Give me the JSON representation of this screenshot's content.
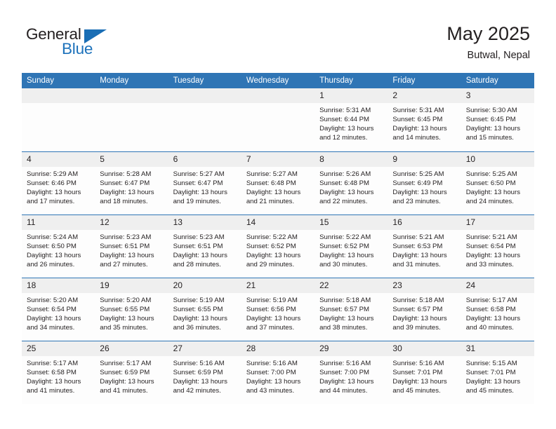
{
  "brand": {
    "name_part1": "General",
    "name_part2": "Blue",
    "accent_color": "#1d72bb",
    "triangle_color": "#1a6eb5"
  },
  "header": {
    "title": "May 2025",
    "subtitle": "Butwal, Nepal"
  },
  "theme": {
    "header_bg": "#2f75b5",
    "header_text": "#ffffff",
    "daynum_bg": "#efefef",
    "cell_bg": "#fdfdfd",
    "text": "#231f20"
  },
  "weekday_headers": [
    "Sunday",
    "Monday",
    "Tuesday",
    "Wednesday",
    "Thursday",
    "Friday",
    "Saturday"
  ],
  "labels": {
    "sunrise_prefix": "Sunrise:",
    "sunset_prefix": "Sunset:",
    "daylight_prefix": "Daylight:"
  },
  "weeks": [
    [
      {
        "day": "",
        "empty": true
      },
      {
        "day": "",
        "empty": true
      },
      {
        "day": "",
        "empty": true
      },
      {
        "day": "",
        "empty": true
      },
      {
        "day": "1",
        "sunrise": "Sunrise: 5:31 AM",
        "sunset": "Sunset: 6:44 PM",
        "daylight_line1": "Daylight: 13 hours",
        "daylight_line2": "and 12 minutes."
      },
      {
        "day": "2",
        "sunrise": "Sunrise: 5:31 AM",
        "sunset": "Sunset: 6:45 PM",
        "daylight_line1": "Daylight: 13 hours",
        "daylight_line2": "and 14 minutes."
      },
      {
        "day": "3",
        "sunrise": "Sunrise: 5:30 AM",
        "sunset": "Sunset: 6:45 PM",
        "daylight_line1": "Daylight: 13 hours",
        "daylight_line2": "and 15 minutes."
      }
    ],
    [
      {
        "day": "4",
        "sunrise": "Sunrise: 5:29 AM",
        "sunset": "Sunset: 6:46 PM",
        "daylight_line1": "Daylight: 13 hours",
        "daylight_line2": "and 17 minutes."
      },
      {
        "day": "5",
        "sunrise": "Sunrise: 5:28 AM",
        "sunset": "Sunset: 6:47 PM",
        "daylight_line1": "Daylight: 13 hours",
        "daylight_line2": "and 18 minutes."
      },
      {
        "day": "6",
        "sunrise": "Sunrise: 5:27 AM",
        "sunset": "Sunset: 6:47 PM",
        "daylight_line1": "Daylight: 13 hours",
        "daylight_line2": "and 19 minutes."
      },
      {
        "day": "7",
        "sunrise": "Sunrise: 5:27 AM",
        "sunset": "Sunset: 6:48 PM",
        "daylight_line1": "Daylight: 13 hours",
        "daylight_line2": "and 21 minutes."
      },
      {
        "day": "8",
        "sunrise": "Sunrise: 5:26 AM",
        "sunset": "Sunset: 6:48 PM",
        "daylight_line1": "Daylight: 13 hours",
        "daylight_line2": "and 22 minutes."
      },
      {
        "day": "9",
        "sunrise": "Sunrise: 5:25 AM",
        "sunset": "Sunset: 6:49 PM",
        "daylight_line1": "Daylight: 13 hours",
        "daylight_line2": "and 23 minutes."
      },
      {
        "day": "10",
        "sunrise": "Sunrise: 5:25 AM",
        "sunset": "Sunset: 6:50 PM",
        "daylight_line1": "Daylight: 13 hours",
        "daylight_line2": "and 24 minutes."
      }
    ],
    [
      {
        "day": "11",
        "sunrise": "Sunrise: 5:24 AM",
        "sunset": "Sunset: 6:50 PM",
        "daylight_line1": "Daylight: 13 hours",
        "daylight_line2": "and 26 minutes."
      },
      {
        "day": "12",
        "sunrise": "Sunrise: 5:23 AM",
        "sunset": "Sunset: 6:51 PM",
        "daylight_line1": "Daylight: 13 hours",
        "daylight_line2": "and 27 minutes."
      },
      {
        "day": "13",
        "sunrise": "Sunrise: 5:23 AM",
        "sunset": "Sunset: 6:51 PM",
        "daylight_line1": "Daylight: 13 hours",
        "daylight_line2": "and 28 minutes."
      },
      {
        "day": "14",
        "sunrise": "Sunrise: 5:22 AM",
        "sunset": "Sunset: 6:52 PM",
        "daylight_line1": "Daylight: 13 hours",
        "daylight_line2": "and 29 minutes."
      },
      {
        "day": "15",
        "sunrise": "Sunrise: 5:22 AM",
        "sunset": "Sunset: 6:52 PM",
        "daylight_line1": "Daylight: 13 hours",
        "daylight_line2": "and 30 minutes."
      },
      {
        "day": "16",
        "sunrise": "Sunrise: 5:21 AM",
        "sunset": "Sunset: 6:53 PM",
        "daylight_line1": "Daylight: 13 hours",
        "daylight_line2": "and 31 minutes."
      },
      {
        "day": "17",
        "sunrise": "Sunrise: 5:21 AM",
        "sunset": "Sunset: 6:54 PM",
        "daylight_line1": "Daylight: 13 hours",
        "daylight_line2": "and 33 minutes."
      }
    ],
    [
      {
        "day": "18",
        "sunrise": "Sunrise: 5:20 AM",
        "sunset": "Sunset: 6:54 PM",
        "daylight_line1": "Daylight: 13 hours",
        "daylight_line2": "and 34 minutes."
      },
      {
        "day": "19",
        "sunrise": "Sunrise: 5:20 AM",
        "sunset": "Sunset: 6:55 PM",
        "daylight_line1": "Daylight: 13 hours",
        "daylight_line2": "and 35 minutes."
      },
      {
        "day": "20",
        "sunrise": "Sunrise: 5:19 AM",
        "sunset": "Sunset: 6:55 PM",
        "daylight_line1": "Daylight: 13 hours",
        "daylight_line2": "and 36 minutes."
      },
      {
        "day": "21",
        "sunrise": "Sunrise: 5:19 AM",
        "sunset": "Sunset: 6:56 PM",
        "daylight_line1": "Daylight: 13 hours",
        "daylight_line2": "and 37 minutes."
      },
      {
        "day": "22",
        "sunrise": "Sunrise: 5:18 AM",
        "sunset": "Sunset: 6:57 PM",
        "daylight_line1": "Daylight: 13 hours",
        "daylight_line2": "and 38 minutes."
      },
      {
        "day": "23",
        "sunrise": "Sunrise: 5:18 AM",
        "sunset": "Sunset: 6:57 PM",
        "daylight_line1": "Daylight: 13 hours",
        "daylight_line2": "and 39 minutes."
      },
      {
        "day": "24",
        "sunrise": "Sunrise: 5:17 AM",
        "sunset": "Sunset: 6:58 PM",
        "daylight_line1": "Daylight: 13 hours",
        "daylight_line2": "and 40 minutes."
      }
    ],
    [
      {
        "day": "25",
        "sunrise": "Sunrise: 5:17 AM",
        "sunset": "Sunset: 6:58 PM",
        "daylight_line1": "Daylight: 13 hours",
        "daylight_line2": "and 41 minutes."
      },
      {
        "day": "26",
        "sunrise": "Sunrise: 5:17 AM",
        "sunset": "Sunset: 6:59 PM",
        "daylight_line1": "Daylight: 13 hours",
        "daylight_line2": "and 41 minutes."
      },
      {
        "day": "27",
        "sunrise": "Sunrise: 5:16 AM",
        "sunset": "Sunset: 6:59 PM",
        "daylight_line1": "Daylight: 13 hours",
        "daylight_line2": "and 42 minutes."
      },
      {
        "day": "28",
        "sunrise": "Sunrise: 5:16 AM",
        "sunset": "Sunset: 7:00 PM",
        "daylight_line1": "Daylight: 13 hours",
        "daylight_line2": "and 43 minutes."
      },
      {
        "day": "29",
        "sunrise": "Sunrise: 5:16 AM",
        "sunset": "Sunset: 7:00 PM",
        "daylight_line1": "Daylight: 13 hours",
        "daylight_line2": "and 44 minutes."
      },
      {
        "day": "30",
        "sunrise": "Sunrise: 5:16 AM",
        "sunset": "Sunset: 7:01 PM",
        "daylight_line1": "Daylight: 13 hours",
        "daylight_line2": "and 45 minutes."
      },
      {
        "day": "31",
        "sunrise": "Sunrise: 5:15 AM",
        "sunset": "Sunset: 7:01 PM",
        "daylight_line1": "Daylight: 13 hours",
        "daylight_line2": "and 45 minutes."
      }
    ]
  ]
}
